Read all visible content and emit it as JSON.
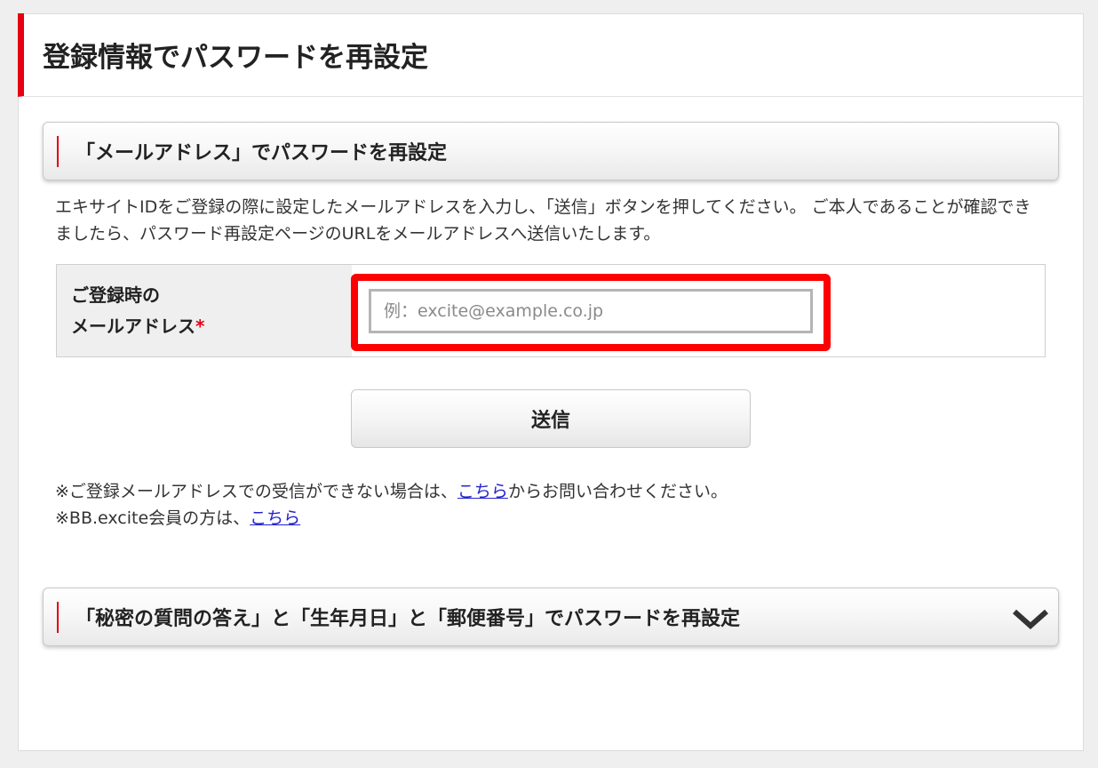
{
  "page": {
    "title": "登録情報でパスワードを再設定"
  },
  "email_section": {
    "heading": "「メールアドレス」でパスワードを再設定",
    "expanded": true,
    "description": "エキサイトIDをご登録の際に設定したメールアドレスを入力し、「送信」ボタンを押してください。 ご本人であることが確認できましたら、パスワード再設定ページのURLをメールアドレスへ送信いたします。",
    "form": {
      "label_line1": "ご登録時の",
      "label_line2": "メールアドレス",
      "required_mark": "*",
      "email": {
        "value": "",
        "placeholder": "例：excite@example.co.jp"
      }
    },
    "submit_label": "送信",
    "notes": [
      {
        "prefix": "※ご登録メールアドレスでの受信ができない場合は、",
        "link": "こちら",
        "suffix": "からお問い合わせください。"
      },
      {
        "prefix": "※BB.excite会員の方は、",
        "link": "こちら",
        "suffix": ""
      }
    ]
  },
  "secret_section": {
    "heading": "「秘密の質問の答え」と「生年月日」と「郵便番号」でパスワードを再設定",
    "expanded": false,
    "toggle_icon": "chevron-down-icon"
  },
  "colors": {
    "accent": "#e60012",
    "highlight": "#ff0000",
    "link": "#2323d0",
    "text": "#222222",
    "page_bg": "#efefef"
  }
}
